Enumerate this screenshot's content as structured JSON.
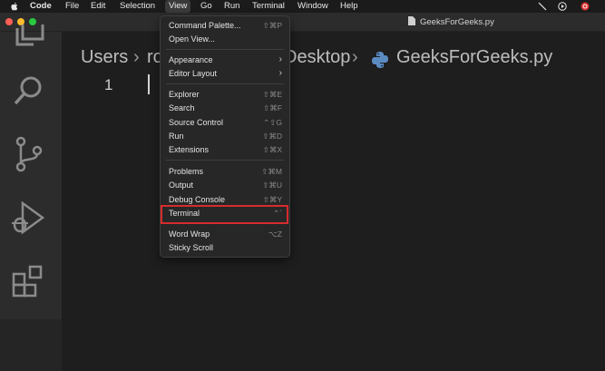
{
  "menubar": {
    "items": [
      "Code",
      "File",
      "Edit",
      "Selection",
      "View",
      "Go",
      "Run",
      "Terminal",
      "Window",
      "Help"
    ],
    "active": "View"
  },
  "window": {
    "title": "GeeksForGeeks.py"
  },
  "breadcrumb": {
    "part1": "Users",
    "part2": "ro",
    "part3": "Desktop",
    "file": "GeeksForGeeks.py"
  },
  "editor": {
    "line_number": "1"
  },
  "view_menu": {
    "items": [
      {
        "label": "Command Palette...",
        "shortcut": "⇧⌘P"
      },
      {
        "label": "Open View...",
        "shortcut": ""
      },
      {
        "label": "Appearance",
        "submenu": true
      },
      {
        "label": "Editor Layout",
        "submenu": true
      },
      {
        "label": "Explorer",
        "shortcut": "⇧⌘E"
      },
      {
        "label": "Search",
        "shortcut": "⇧⌘F"
      },
      {
        "label": "Source Control",
        "shortcut": "⌃⇧G"
      },
      {
        "label": "Run",
        "shortcut": "⇧⌘D"
      },
      {
        "label": "Extensions",
        "shortcut": "⇧⌘X"
      },
      {
        "label": "Problems",
        "shortcut": "⇧⌘M"
      },
      {
        "label": "Output",
        "shortcut": "⇧⌘U"
      },
      {
        "label": "Debug Console",
        "shortcut": "⇧⌘Y"
      },
      {
        "label": "Terminal",
        "shortcut": "⌃`"
      },
      {
        "label": "Word Wrap",
        "shortcut": "⌥Z"
      },
      {
        "label": "Sticky Scroll",
        "shortcut": ""
      }
    ],
    "highlighted": "Terminal"
  },
  "colors": {
    "highlight_border": "#d62c2c",
    "close": "#ff5f57",
    "minimize": "#febc2e",
    "zoom": "#28c840"
  },
  "icons": [
    "apple-icon",
    "explorer-icon",
    "search-icon",
    "source-control-icon",
    "run-debug-icon",
    "extensions-icon",
    "python-file-icon"
  ]
}
